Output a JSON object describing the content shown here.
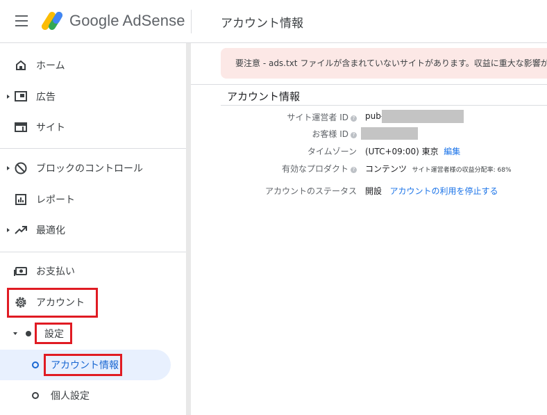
{
  "header": {
    "app_name": "Google AdSense",
    "page_title": "アカウント情報"
  },
  "sidebar": {
    "items": [
      {
        "label": "ホーム",
        "icon": "home-icon"
      },
      {
        "label": "広告",
        "icon": "ads-icon"
      },
      {
        "label": "サイト",
        "icon": "sites-icon"
      },
      {
        "label": "ブロックのコントロール",
        "icon": "block-icon"
      },
      {
        "label": "レポート",
        "icon": "report-icon"
      },
      {
        "label": "最適化",
        "icon": "trending-up-icon"
      },
      {
        "label": "お支払い",
        "icon": "payments-icon"
      },
      {
        "label": "アカウント",
        "icon": "gear-icon"
      }
    ],
    "settings_label": "設定",
    "sub_items": [
      {
        "label": "アカウント情報",
        "active": true
      },
      {
        "label": "個人設定",
        "active": false
      }
    ]
  },
  "alert": {
    "text": "要注意 - ads.txt ファイルが含まれていないサイトがあります。収益に重大な影響が出か"
  },
  "account_info": {
    "title": "アカウント情報",
    "publisher_id_label": "サイト運営者 ID",
    "publisher_id_prefix": "pub-",
    "customer_id_label": "お客様 ID",
    "timezone_label": "タイムゾーン",
    "timezone_value": "(UTC+09:00) 東京",
    "timezone_edit": "編集",
    "products_label": "有効なプロダクト",
    "products_value": "コンテンツ",
    "products_note": "サイト運営者様の収益分配率: 68%",
    "status_label": "アカウントのステータス",
    "status_value": "開設",
    "status_link": "アカウントの利用を停止する"
  },
  "colors": {
    "highlight": "#e01b23",
    "active_bg": "#e8f0fe",
    "link": "#1a73e8",
    "alert_bg": "#fce8e6"
  }
}
